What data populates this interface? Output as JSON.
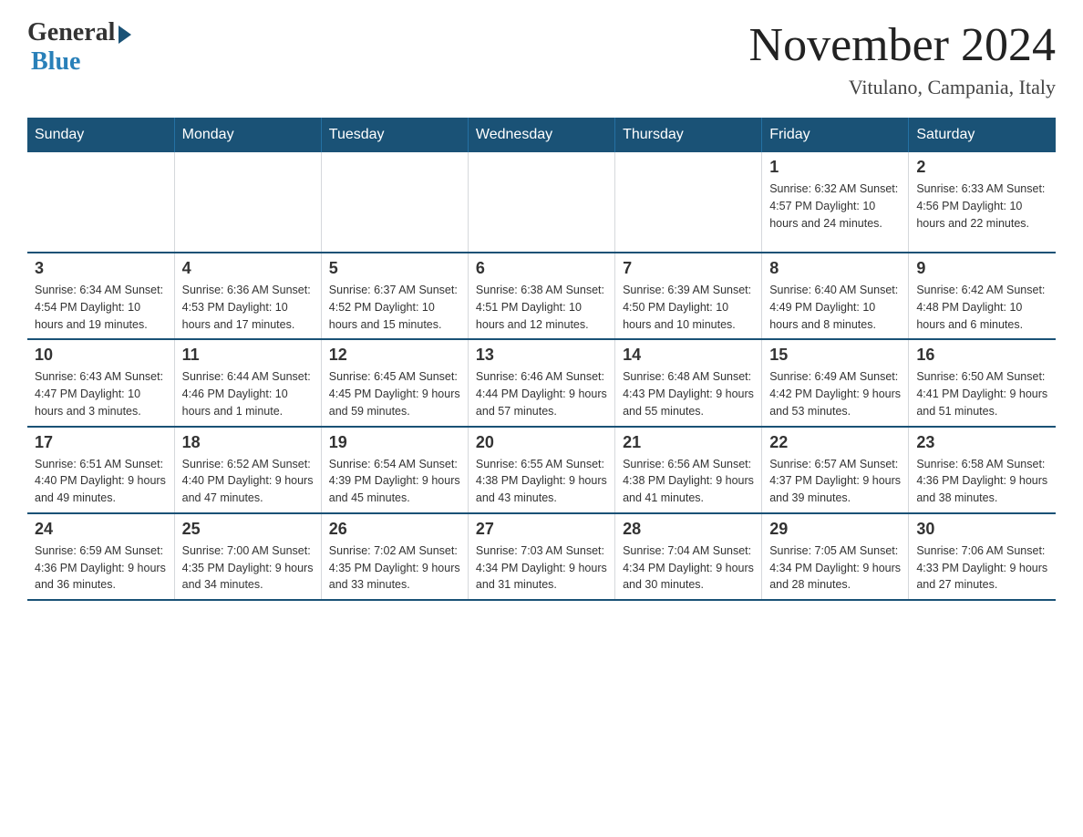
{
  "header": {
    "logo_general": "General",
    "logo_blue": "Blue",
    "month_year": "November 2024",
    "location": "Vitulano, Campania, Italy"
  },
  "days_of_week": [
    "Sunday",
    "Monday",
    "Tuesday",
    "Wednesday",
    "Thursday",
    "Friday",
    "Saturday"
  ],
  "weeks": [
    [
      {
        "day": "",
        "info": ""
      },
      {
        "day": "",
        "info": ""
      },
      {
        "day": "",
        "info": ""
      },
      {
        "day": "",
        "info": ""
      },
      {
        "day": "",
        "info": ""
      },
      {
        "day": "1",
        "info": "Sunrise: 6:32 AM\nSunset: 4:57 PM\nDaylight: 10 hours and 24 minutes."
      },
      {
        "day": "2",
        "info": "Sunrise: 6:33 AM\nSunset: 4:56 PM\nDaylight: 10 hours and 22 minutes."
      }
    ],
    [
      {
        "day": "3",
        "info": "Sunrise: 6:34 AM\nSunset: 4:54 PM\nDaylight: 10 hours and 19 minutes."
      },
      {
        "day": "4",
        "info": "Sunrise: 6:36 AM\nSunset: 4:53 PM\nDaylight: 10 hours and 17 minutes."
      },
      {
        "day": "5",
        "info": "Sunrise: 6:37 AM\nSunset: 4:52 PM\nDaylight: 10 hours and 15 minutes."
      },
      {
        "day": "6",
        "info": "Sunrise: 6:38 AM\nSunset: 4:51 PM\nDaylight: 10 hours and 12 minutes."
      },
      {
        "day": "7",
        "info": "Sunrise: 6:39 AM\nSunset: 4:50 PM\nDaylight: 10 hours and 10 minutes."
      },
      {
        "day": "8",
        "info": "Sunrise: 6:40 AM\nSunset: 4:49 PM\nDaylight: 10 hours and 8 minutes."
      },
      {
        "day": "9",
        "info": "Sunrise: 6:42 AM\nSunset: 4:48 PM\nDaylight: 10 hours and 6 minutes."
      }
    ],
    [
      {
        "day": "10",
        "info": "Sunrise: 6:43 AM\nSunset: 4:47 PM\nDaylight: 10 hours and 3 minutes."
      },
      {
        "day": "11",
        "info": "Sunrise: 6:44 AM\nSunset: 4:46 PM\nDaylight: 10 hours and 1 minute."
      },
      {
        "day": "12",
        "info": "Sunrise: 6:45 AM\nSunset: 4:45 PM\nDaylight: 9 hours and 59 minutes."
      },
      {
        "day": "13",
        "info": "Sunrise: 6:46 AM\nSunset: 4:44 PM\nDaylight: 9 hours and 57 minutes."
      },
      {
        "day": "14",
        "info": "Sunrise: 6:48 AM\nSunset: 4:43 PM\nDaylight: 9 hours and 55 minutes."
      },
      {
        "day": "15",
        "info": "Sunrise: 6:49 AM\nSunset: 4:42 PM\nDaylight: 9 hours and 53 minutes."
      },
      {
        "day": "16",
        "info": "Sunrise: 6:50 AM\nSunset: 4:41 PM\nDaylight: 9 hours and 51 minutes."
      }
    ],
    [
      {
        "day": "17",
        "info": "Sunrise: 6:51 AM\nSunset: 4:40 PM\nDaylight: 9 hours and 49 minutes."
      },
      {
        "day": "18",
        "info": "Sunrise: 6:52 AM\nSunset: 4:40 PM\nDaylight: 9 hours and 47 minutes."
      },
      {
        "day": "19",
        "info": "Sunrise: 6:54 AM\nSunset: 4:39 PM\nDaylight: 9 hours and 45 minutes."
      },
      {
        "day": "20",
        "info": "Sunrise: 6:55 AM\nSunset: 4:38 PM\nDaylight: 9 hours and 43 minutes."
      },
      {
        "day": "21",
        "info": "Sunrise: 6:56 AM\nSunset: 4:38 PM\nDaylight: 9 hours and 41 minutes."
      },
      {
        "day": "22",
        "info": "Sunrise: 6:57 AM\nSunset: 4:37 PM\nDaylight: 9 hours and 39 minutes."
      },
      {
        "day": "23",
        "info": "Sunrise: 6:58 AM\nSunset: 4:36 PM\nDaylight: 9 hours and 38 minutes."
      }
    ],
    [
      {
        "day": "24",
        "info": "Sunrise: 6:59 AM\nSunset: 4:36 PM\nDaylight: 9 hours and 36 minutes."
      },
      {
        "day": "25",
        "info": "Sunrise: 7:00 AM\nSunset: 4:35 PM\nDaylight: 9 hours and 34 minutes."
      },
      {
        "day": "26",
        "info": "Sunrise: 7:02 AM\nSunset: 4:35 PM\nDaylight: 9 hours and 33 minutes."
      },
      {
        "day": "27",
        "info": "Sunrise: 7:03 AM\nSunset: 4:34 PM\nDaylight: 9 hours and 31 minutes."
      },
      {
        "day": "28",
        "info": "Sunrise: 7:04 AM\nSunset: 4:34 PM\nDaylight: 9 hours and 30 minutes."
      },
      {
        "day": "29",
        "info": "Sunrise: 7:05 AM\nSunset: 4:34 PM\nDaylight: 9 hours and 28 minutes."
      },
      {
        "day": "30",
        "info": "Sunrise: 7:06 AM\nSunset: 4:33 PM\nDaylight: 9 hours and 27 minutes."
      }
    ]
  ]
}
